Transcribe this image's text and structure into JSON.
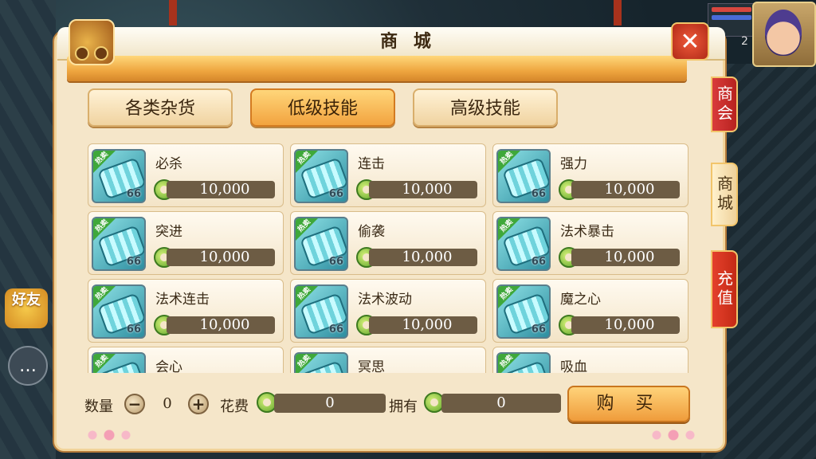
{
  "window": {
    "title": "商 城"
  },
  "tabs": [
    {
      "label": "各类杂货",
      "active": false
    },
    {
      "label": "低级技能",
      "active": true
    },
    {
      "label": "高级技能",
      "active": false
    }
  ],
  "items": [
    {
      "name": "必杀",
      "price": "10,000",
      "badge": "热卖",
      "level": "66"
    },
    {
      "name": "连击",
      "price": "10,000",
      "badge": "热卖",
      "level": "66"
    },
    {
      "name": "强力",
      "price": "10,000",
      "badge": "热卖",
      "level": "66"
    },
    {
      "name": "突进",
      "price": "10,000",
      "badge": "热卖",
      "level": "66"
    },
    {
      "name": "偷袭",
      "price": "10,000",
      "badge": "热卖",
      "level": "66"
    },
    {
      "name": "法术暴击",
      "price": "10,000",
      "badge": "热卖",
      "level": "66"
    },
    {
      "name": "法术连击",
      "price": "10,000",
      "badge": "热卖",
      "level": "66"
    },
    {
      "name": "法术波动",
      "price": "10,000",
      "badge": "热卖",
      "level": "66"
    },
    {
      "name": "魔之心",
      "price": "10,000",
      "badge": "热卖",
      "level": "66"
    },
    {
      "name": "会心",
      "price": "",
      "badge": "热卖",
      "level": "66"
    },
    {
      "name": "冥思",
      "price": "",
      "badge": "热卖",
      "level": "66"
    },
    {
      "name": "吸血",
      "price": "",
      "badge": "热卖",
      "level": "66"
    }
  ],
  "bottom": {
    "quantity_label": "数量",
    "quantity_value": "0",
    "minus": "−",
    "plus": "+",
    "cost_label": "花费",
    "cost_value": "0",
    "owned_label": "拥有",
    "owned_value": "0",
    "buy_label": "购 买"
  },
  "side_tabs": [
    {
      "label": "商会"
    },
    {
      "label": "商城"
    },
    {
      "label": "充值"
    }
  ],
  "hud": {
    "level_text": "2"
  },
  "friend": {
    "label": "好友"
  },
  "close_icon": "✕",
  "chat_icon": "…"
}
